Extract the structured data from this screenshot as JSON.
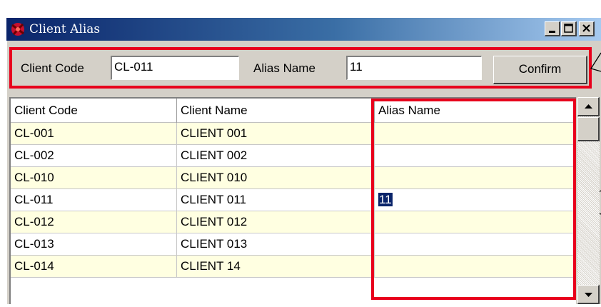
{
  "window": {
    "title": "Client Alias",
    "minimize_label": "minimize",
    "maximize_label": "maximize",
    "close_label": "close"
  },
  "form": {
    "client_code_label": "Client Code",
    "client_code_value": "CL-011",
    "alias_name_label": "Alias Name",
    "alias_name_value": "11",
    "confirm_label": "Confirm"
  },
  "table": {
    "columns": [
      "Client Code",
      "Client Name",
      "Alias Name"
    ],
    "rows": [
      {
        "code": "CL-001",
        "name": "CLIENT 001",
        "alias": ""
      },
      {
        "code": "CL-002",
        "name": "CLIENT 002",
        "alias": ""
      },
      {
        "code": "CL-010",
        "name": "CLIENT 010",
        "alias": ""
      },
      {
        "code": "CL-011",
        "name": "CLIENT 011",
        "alias": "11"
      },
      {
        "code": "CL-012",
        "name": "CLIENT 012",
        "alias": ""
      },
      {
        "code": "CL-013",
        "name": "CLIENT 013",
        "alias": ""
      },
      {
        "code": "CL-014",
        "name": "CLIENT 14",
        "alias": ""
      }
    ],
    "selected_row": 3
  },
  "colors": {
    "highlight_border": "#e8001c",
    "title_bar": "#0a246a",
    "alt_row": "#ffffe1",
    "selection": "#0a246a"
  }
}
